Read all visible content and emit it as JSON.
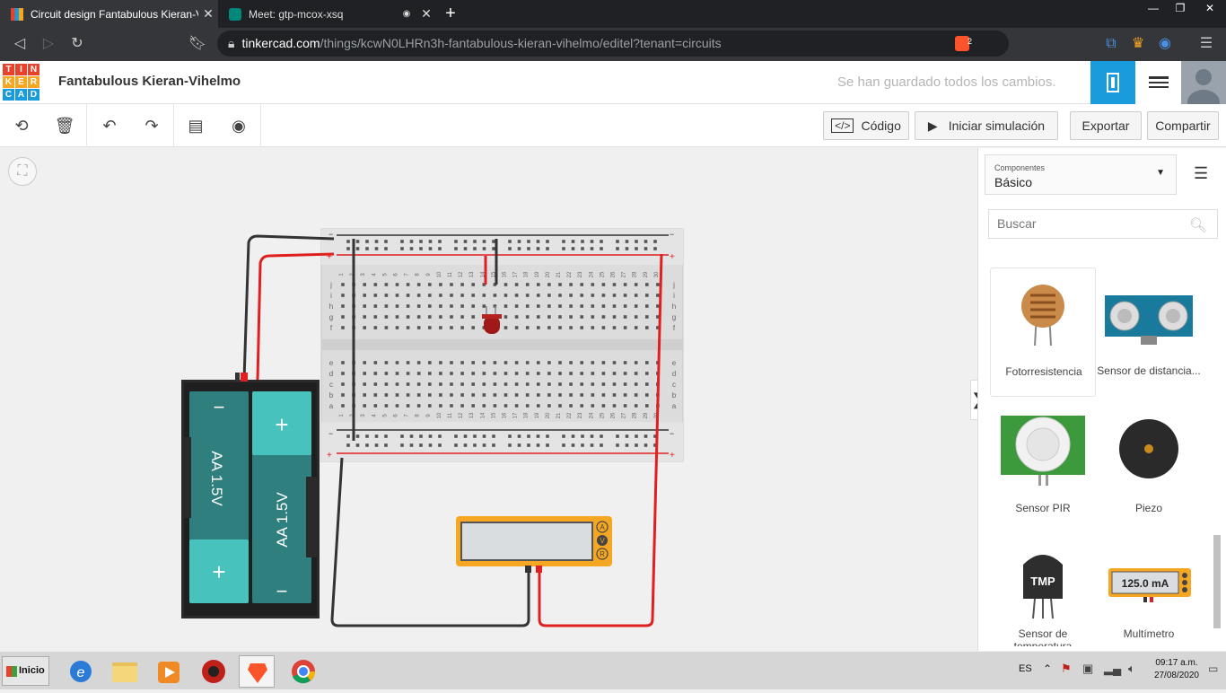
{
  "browser": {
    "tabs": [
      {
        "title": "Circuit design Fantabulous Kieran-Vihe",
        "active": true
      },
      {
        "title": "Meet: gtp-mcox-xsq",
        "active": false
      }
    ],
    "new_tab_label": "+",
    "url_host": "tinkercad.com",
    "url_path": "/things/kcwN0LHRn3h-fantabulous-kieran-vihelmo/editel?tenant=circuits",
    "brave_badge": "2"
  },
  "app": {
    "logo_letters": [
      "T",
      "I",
      "N",
      "K",
      "E",
      "R",
      "C",
      "A",
      "D"
    ],
    "design_title": "Fantabulous Kieran-Vihelmo",
    "save_status": "Se han guardado todos los cambios."
  },
  "toolbar": {
    "code_label": "Código",
    "simulate_label": "Iniciar simulación",
    "export_label": "Exportar",
    "share_label": "Compartir"
  },
  "panel": {
    "category_label": "Componentes",
    "category_value": "Básico",
    "search_placeholder": "Buscar",
    "components": [
      {
        "label": "Fotorresistencia"
      },
      {
        "label": "Sensor de distancia..."
      },
      {
        "label": "Sensor PIR"
      },
      {
        "label": "Piezo"
      },
      {
        "label": "Sensor de temperatura"
      },
      {
        "label": "Multímetro"
      }
    ],
    "multimeter_icon_reading": "125.0 mA",
    "tmp_label": "TMP"
  },
  "circuit": {
    "battery_labels": [
      "AA 1.5V",
      "AA 1.5V"
    ],
    "battery_signs": [
      "−",
      "+",
      "+",
      "−"
    ],
    "multimeter_modes": [
      "A",
      "V",
      "R"
    ],
    "breadboard_rows_top": [
      "j",
      "i",
      "h",
      "g",
      "f"
    ],
    "breadboard_rows_bottom": [
      "e",
      "d",
      "c",
      "b",
      "a"
    ],
    "breadboard_columns": [
      "1",
      "2",
      "3",
      "4",
      "5",
      "6",
      "7",
      "8",
      "9",
      "10",
      "11",
      "12",
      "13",
      "14",
      "15",
      "16",
      "17",
      "18",
      "19",
      "20",
      "21",
      "22",
      "23",
      "24",
      "25",
      "26",
      "27",
      "28",
      "29",
      "30"
    ]
  },
  "taskbar": {
    "start_label": "Inicio",
    "language": "ES",
    "time": "09:17 a.m.",
    "date": "27/08/2020"
  },
  "colors": {
    "accent": "#1a9bdb",
    "wire_red": "#e02020",
    "wire_black": "#333333",
    "battery_teal": "#2e7f7e",
    "multimeter_yellow": "#f5a623"
  }
}
